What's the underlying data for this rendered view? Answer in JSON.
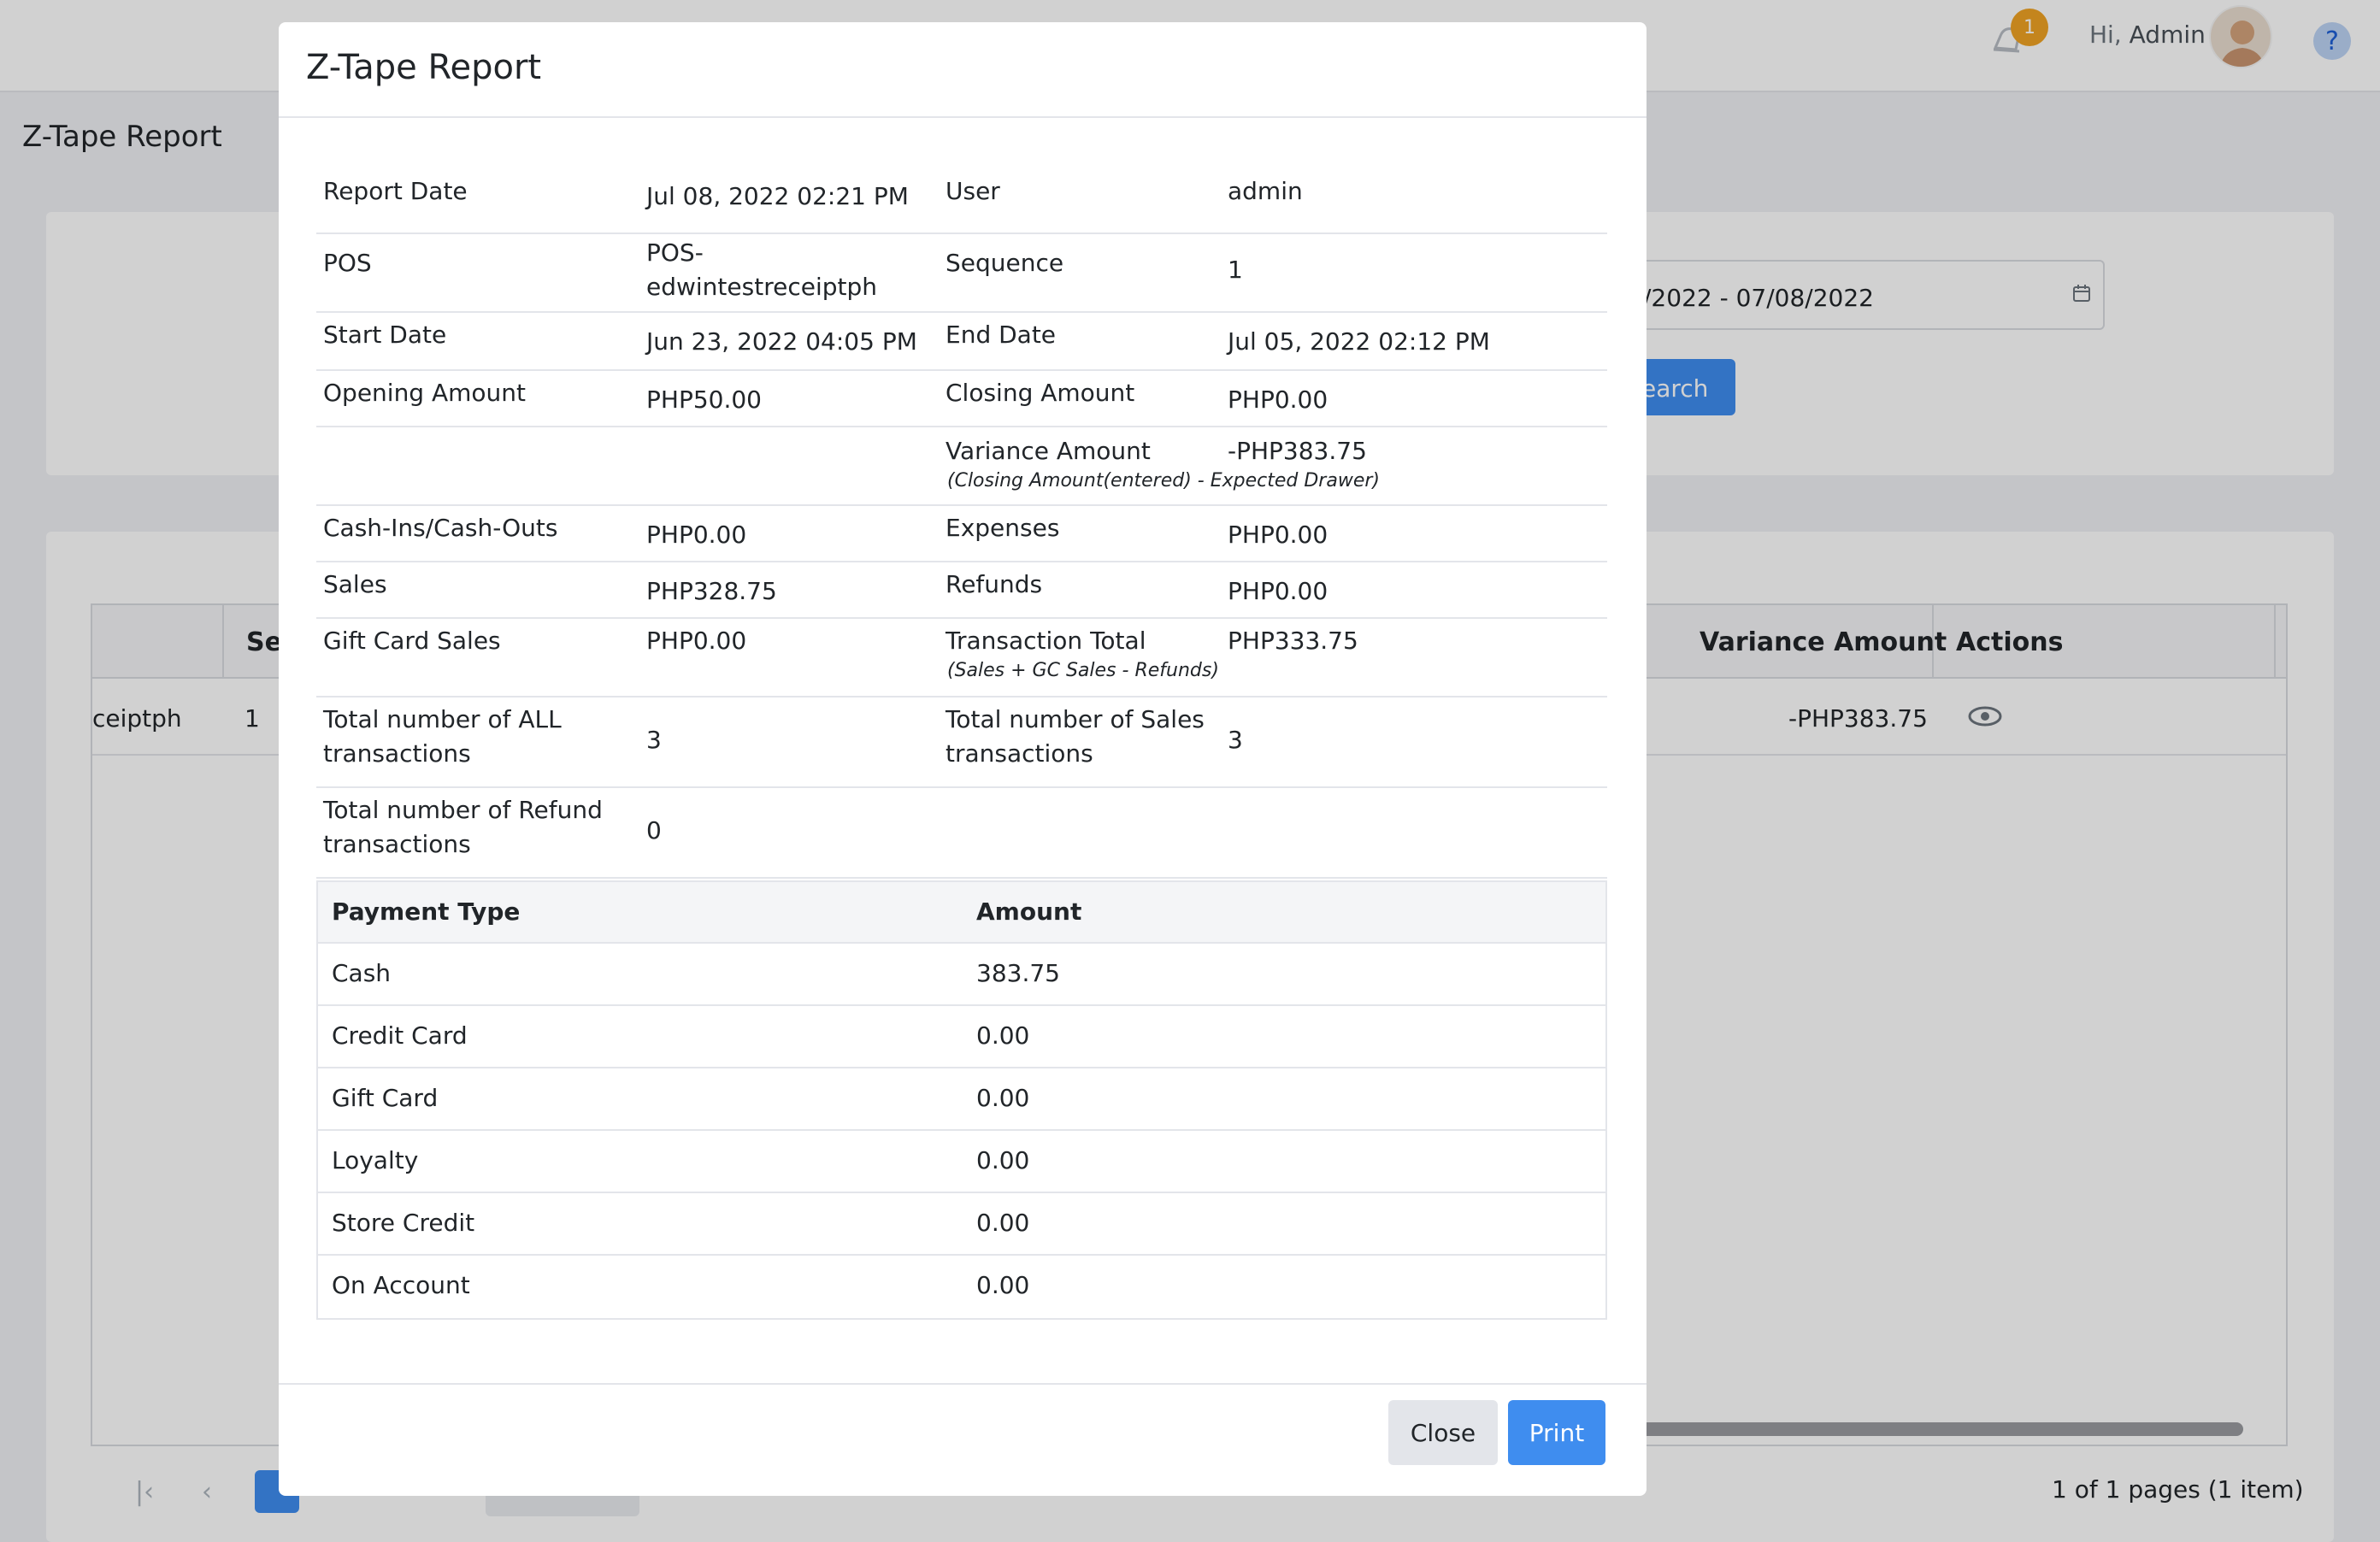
{
  "header": {
    "notification_count": "1",
    "greeting": "Hi,",
    "user_name": "Admin",
    "help_icon": "?"
  },
  "page": {
    "title": "Z-Tape Report",
    "date_range": "/2022 - 07/08/2022",
    "search_label": "earch"
  },
  "grid": {
    "columns": {
      "sequence": "Se",
      "variance": "Variance Amount",
      "actions": "Actions"
    },
    "row": {
      "pos": "ceiptph",
      "sequence": "1",
      "variance": "-PHP383.75"
    }
  },
  "pager": {
    "info": "1 of 1 pages (1 item)"
  },
  "modal": {
    "title": "Z-Tape Report",
    "report_date_label": "Report Date",
    "report_date": "Jul 08, 2022 02:21 PM",
    "user_label": "User",
    "user": "admin",
    "pos_label": "POS",
    "pos_line1": "POS-",
    "pos_line2": "edwintestreceiptph",
    "sequence_label": "Sequence",
    "sequence": "1",
    "start_date_label": "Start Date",
    "start_date": "Jun 23, 2022 04:05 PM",
    "end_date_label": "End Date",
    "end_date": "Jul 05, 2022 02:12 PM",
    "opening_amount_label": "Opening Amount",
    "opening_amount": "PHP50.00",
    "closing_amount_label": "Closing Amount",
    "closing_amount": "PHP0.00",
    "variance_amount_label": "Variance Amount",
    "variance_amount": "-PHP383.75",
    "variance_note": "(Closing Amount(entered) - Expected Drawer)",
    "cash_ins_label": "Cash-Ins/Cash-Outs",
    "cash_ins": "PHP0.00",
    "expenses_label": "Expenses",
    "expenses": "PHP0.00",
    "sales_label": "Sales",
    "sales": "PHP328.75",
    "refunds_label": "Refunds",
    "refunds": "PHP0.00",
    "gift_card_sales_label": "Gift Card Sales",
    "gift_card_sales": "PHP0.00",
    "transaction_total_label": "Transaction Total",
    "transaction_total": "PHP333.75",
    "transaction_total_note": "(Sales + GC Sales - Refunds)",
    "total_all_label_1": "Total number of ALL",
    "total_all_label_2": "transactions",
    "total_all": "3",
    "total_sales_label_1": "Total number of Sales",
    "total_sales_label_2": "transactions",
    "total_sales": "3",
    "total_refund_label_1": "Total number of Refund",
    "total_refund_label_2": "transactions",
    "total_refund": "0",
    "payment_header": {
      "type": "Payment Type",
      "amount": "Amount"
    },
    "payments": [
      {
        "type": "Cash",
        "amount": "383.75"
      },
      {
        "type": "Credit Card",
        "amount": "0.00"
      },
      {
        "type": "Gift Card",
        "amount": "0.00"
      },
      {
        "type": "Loyalty",
        "amount": "0.00"
      },
      {
        "type": "Store Credit",
        "amount": "0.00"
      },
      {
        "type": "On Account",
        "amount": "0.00"
      }
    ],
    "close_label": "Close",
    "print_label": "Print"
  },
  "colors": {
    "primary": "#3f8def",
    "badge": "#f0a324",
    "overlay": "rgba(0,0,0,0.18)"
  }
}
